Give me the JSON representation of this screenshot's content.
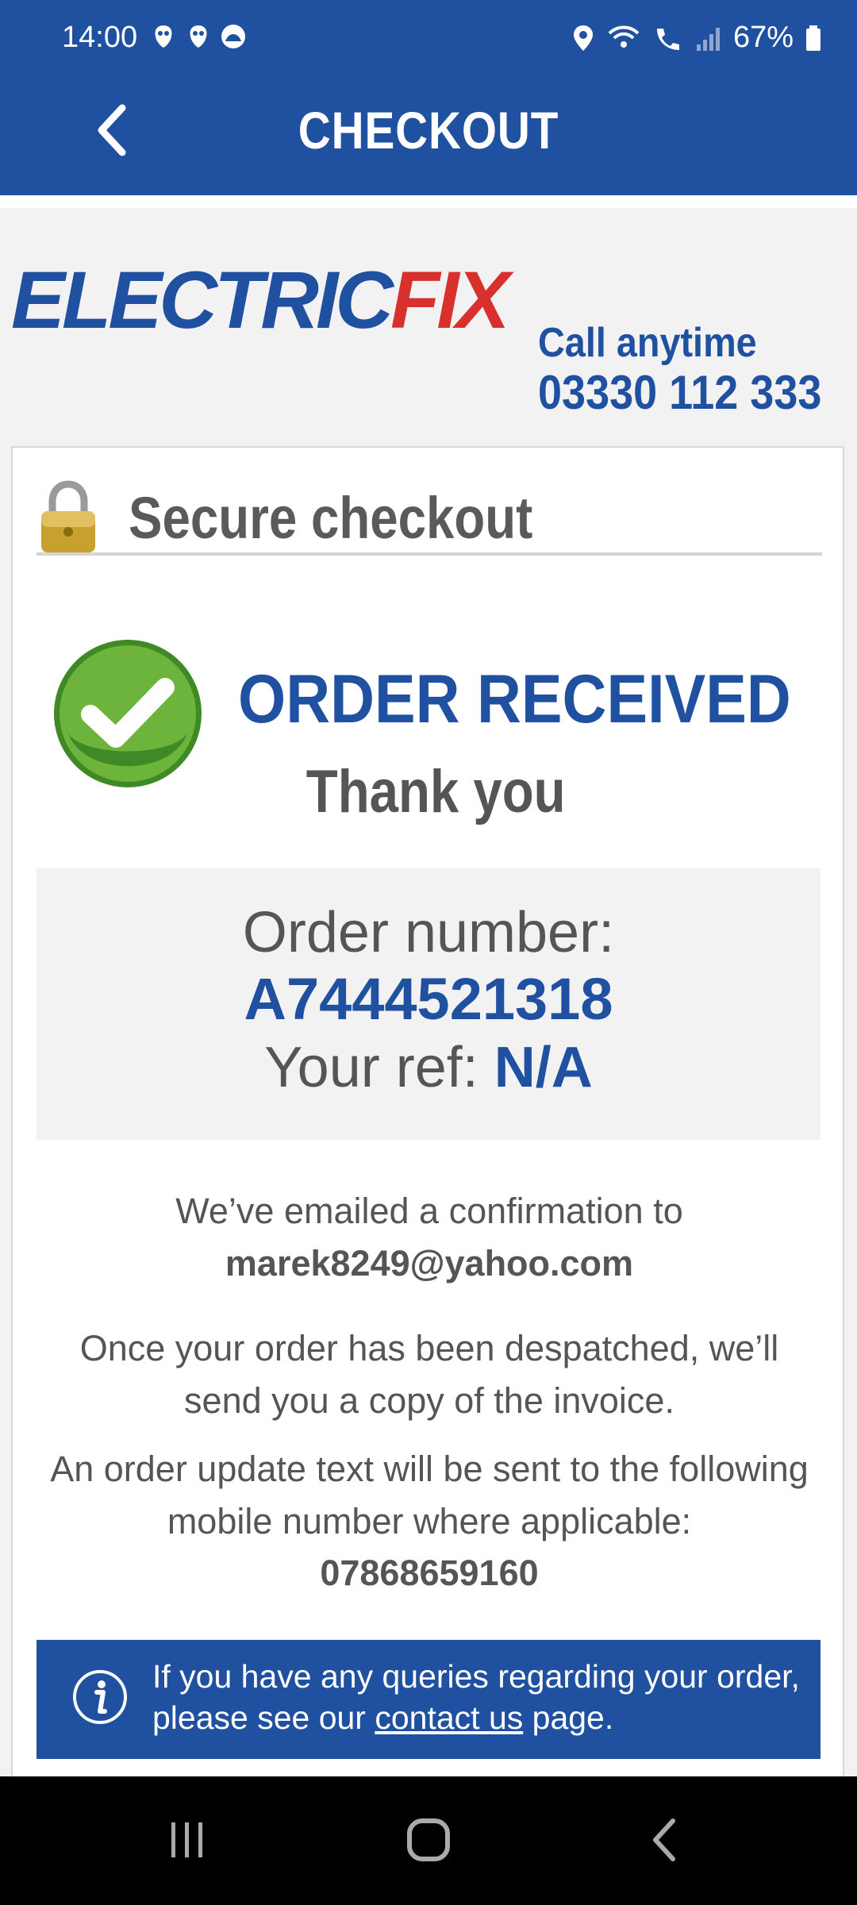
{
  "status_bar": {
    "time": "14:00",
    "battery": "67%",
    "icons_left": [
      "bank-app-icon",
      "bank-app-icon",
      "cloud-app-icon"
    ],
    "icons_right": [
      "location-icon",
      "wifi-icon",
      "wifi-call-icon",
      "signal-icon",
      "battery-icon"
    ]
  },
  "header": {
    "title": "CHECKOUT",
    "back_icon": "chevron-left-icon"
  },
  "brand": {
    "logo_part1": "ELECTRIC",
    "logo_part2": "FIX",
    "call_label": "Call anytime",
    "phone": "03330 112 333"
  },
  "secure": {
    "title": "Secure checkout",
    "icon": "padlock-icon"
  },
  "confirmation": {
    "heading": "ORDER RECEIVED",
    "subheading": "Thank you",
    "icon": "checkmark-icon",
    "order_label": "Order number:",
    "order_number": "A7444521318",
    "ref_label": "Your ref: ",
    "ref_value": "N/A"
  },
  "messages": {
    "email_line": "We’ve emailed a confirmation to",
    "email": "marek8249@yahoo.com",
    "despatch": "Once your order has been despatched, we’ll send you a copy of the invoice.",
    "update": "An order update text will be sent to the following mobile number where applicable:",
    "mobile": "07868659160"
  },
  "info": {
    "icon": "info-icon",
    "text_before": "If you have any queries regarding your order, please see our ",
    "link": "contact us",
    "text_after": " page."
  },
  "nav": {
    "icons": [
      "recent-apps-icon",
      "home-icon",
      "back-icon"
    ]
  },
  "colors": {
    "brand_blue": "#2050a0",
    "brand_red": "#d8302c",
    "text_gray": "#555555",
    "success_green": "#5aa032"
  }
}
